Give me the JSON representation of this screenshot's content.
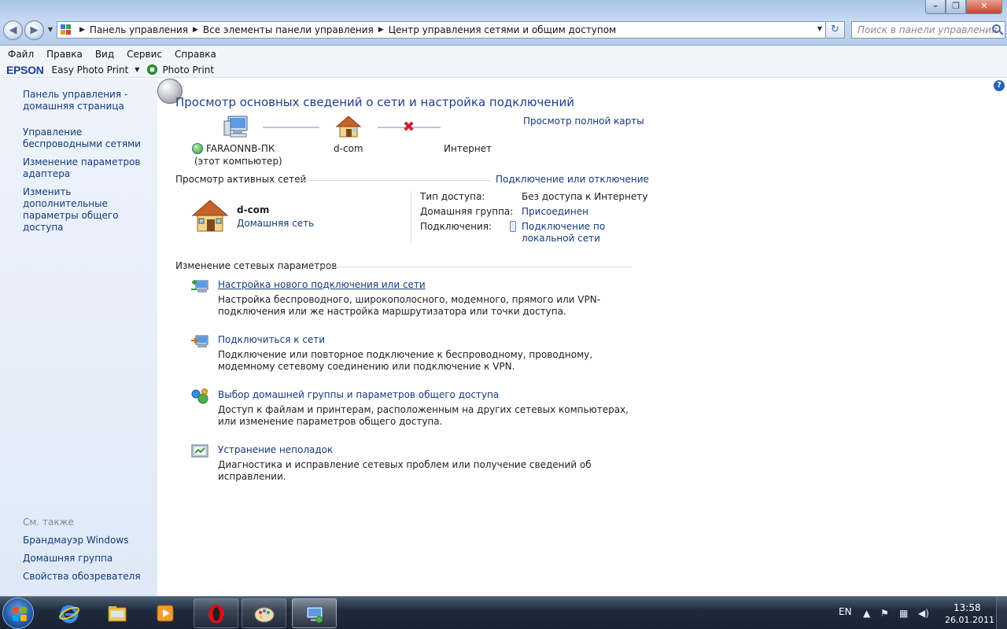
{
  "window": {
    "breadcrumbs": [
      "Панель управления",
      "Все элементы панели управления",
      "Центр управления сетями и общим доступом"
    ],
    "search_placeholder": "Поиск в панели управления"
  },
  "menu": [
    "Файл",
    "Правка",
    "Вид",
    "Сервис",
    "Справка"
  ],
  "epson_toolbar": {
    "logo": "EPSON",
    "easy_photo_print": "Easy Photo Print",
    "photo_print": "Photo Print"
  },
  "left_nav": {
    "links": [
      "Панель управления - домашняя страница",
      "Управление беспроводными сетями",
      "Изменение параметров адаптера",
      "Изменить дополнительные параметры общего доступа"
    ],
    "see_also_title": "См. также",
    "see_also": [
      "Брандмауэр Windows",
      "Домашняя группа",
      "Свойства обозревателя"
    ]
  },
  "main": {
    "title": "Просмотр основных сведений о сети и настройка подключений",
    "full_map_link": "Просмотр полной карты",
    "map": {
      "computer_name": "FARAONNB-ПК",
      "computer_sub": "(этот компьютер)",
      "network": "d-com",
      "internet": "Интернет"
    },
    "active_networks_title": "Просмотр активных сетей",
    "connect_toggle_link": "Подключение или отключение",
    "active_network": {
      "name": "d-com",
      "type": "Домашняя сеть",
      "access_type_label": "Тип доступа:",
      "access_type_value": "Без доступа к Интернету",
      "homegroup_label": "Домашняя группа:",
      "homegroup_value": "Присоединен",
      "connections_label": "Подключения:",
      "connections_value_line1": "Подключение по",
      "connections_value_line2": "локальной сети"
    },
    "change_settings_title": "Изменение сетевых параметров",
    "tasks": [
      {
        "link": "Настройка нового подключения или сети",
        "desc": "Настройка беспроводного, широкополосного, модемного, прямого или VPN-подключения или же настройка маршрутизатора или точки доступа."
      },
      {
        "link": "Подключиться к сети",
        "desc": "Подключение или повторное подключение к беспроводному, проводному, модемному сетевому соединению или подключение к VPN."
      },
      {
        "link": "Выбор домашней группы и параметров общего доступа",
        "desc": "Доступ к файлам и принтерам, расположенным на других сетевых компьютерах, или изменение параметров общего доступа."
      },
      {
        "link": "Устранение неполадок",
        "desc": "Диагностика и исправление сетевых проблем или получение сведений об исправлении."
      }
    ]
  },
  "taskbar": {
    "language": "EN",
    "time": "13:58",
    "date": "26.01.2011"
  },
  "colors": {
    "link": "#133a7c",
    "title": "#1e3e8e",
    "error_x": "#d0202a"
  }
}
